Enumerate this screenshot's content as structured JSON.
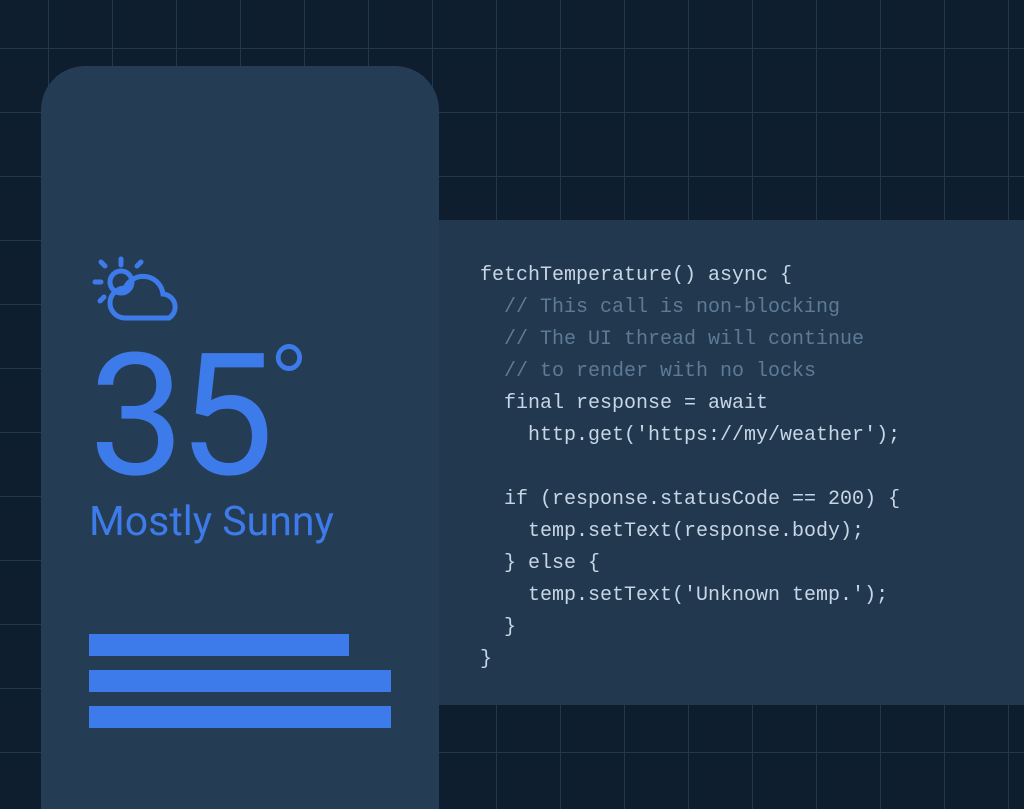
{
  "colors": {
    "background": "#0F1E2E",
    "grid": "#21384F",
    "phone": "#253C55",
    "panel": "#21384F",
    "accent": "#3E7BEA",
    "code_fg": "#C7D6E4",
    "code_comment": "#5E7A94"
  },
  "weather": {
    "icon": "sun-cloud-icon",
    "temperature": "35",
    "degree_symbol": "°",
    "condition": "Mostly Sunny"
  },
  "code": {
    "lines": [
      {
        "text": "fetchTemperature() async {",
        "dim": false
      },
      {
        "text": "  // This call is non-blocking",
        "dim": true
      },
      {
        "text": "  // The UI thread will continue",
        "dim": true
      },
      {
        "text": "  // to render with no locks",
        "dim": true
      },
      {
        "text": "  final response = await",
        "dim": false
      },
      {
        "text": "    http.get('https://my/weather');",
        "dim": false
      },
      {
        "text": "",
        "dim": false
      },
      {
        "text": "  if (response.statusCode == 200) {",
        "dim": false
      },
      {
        "text": "    temp.setText(response.body);",
        "dim": false
      },
      {
        "text": "  } else {",
        "dim": false
      },
      {
        "text": "    temp.setText('Unknown temp.');",
        "dim": false
      },
      {
        "text": "  }",
        "dim": false
      },
      {
        "text": "}",
        "dim": false
      }
    ]
  }
}
